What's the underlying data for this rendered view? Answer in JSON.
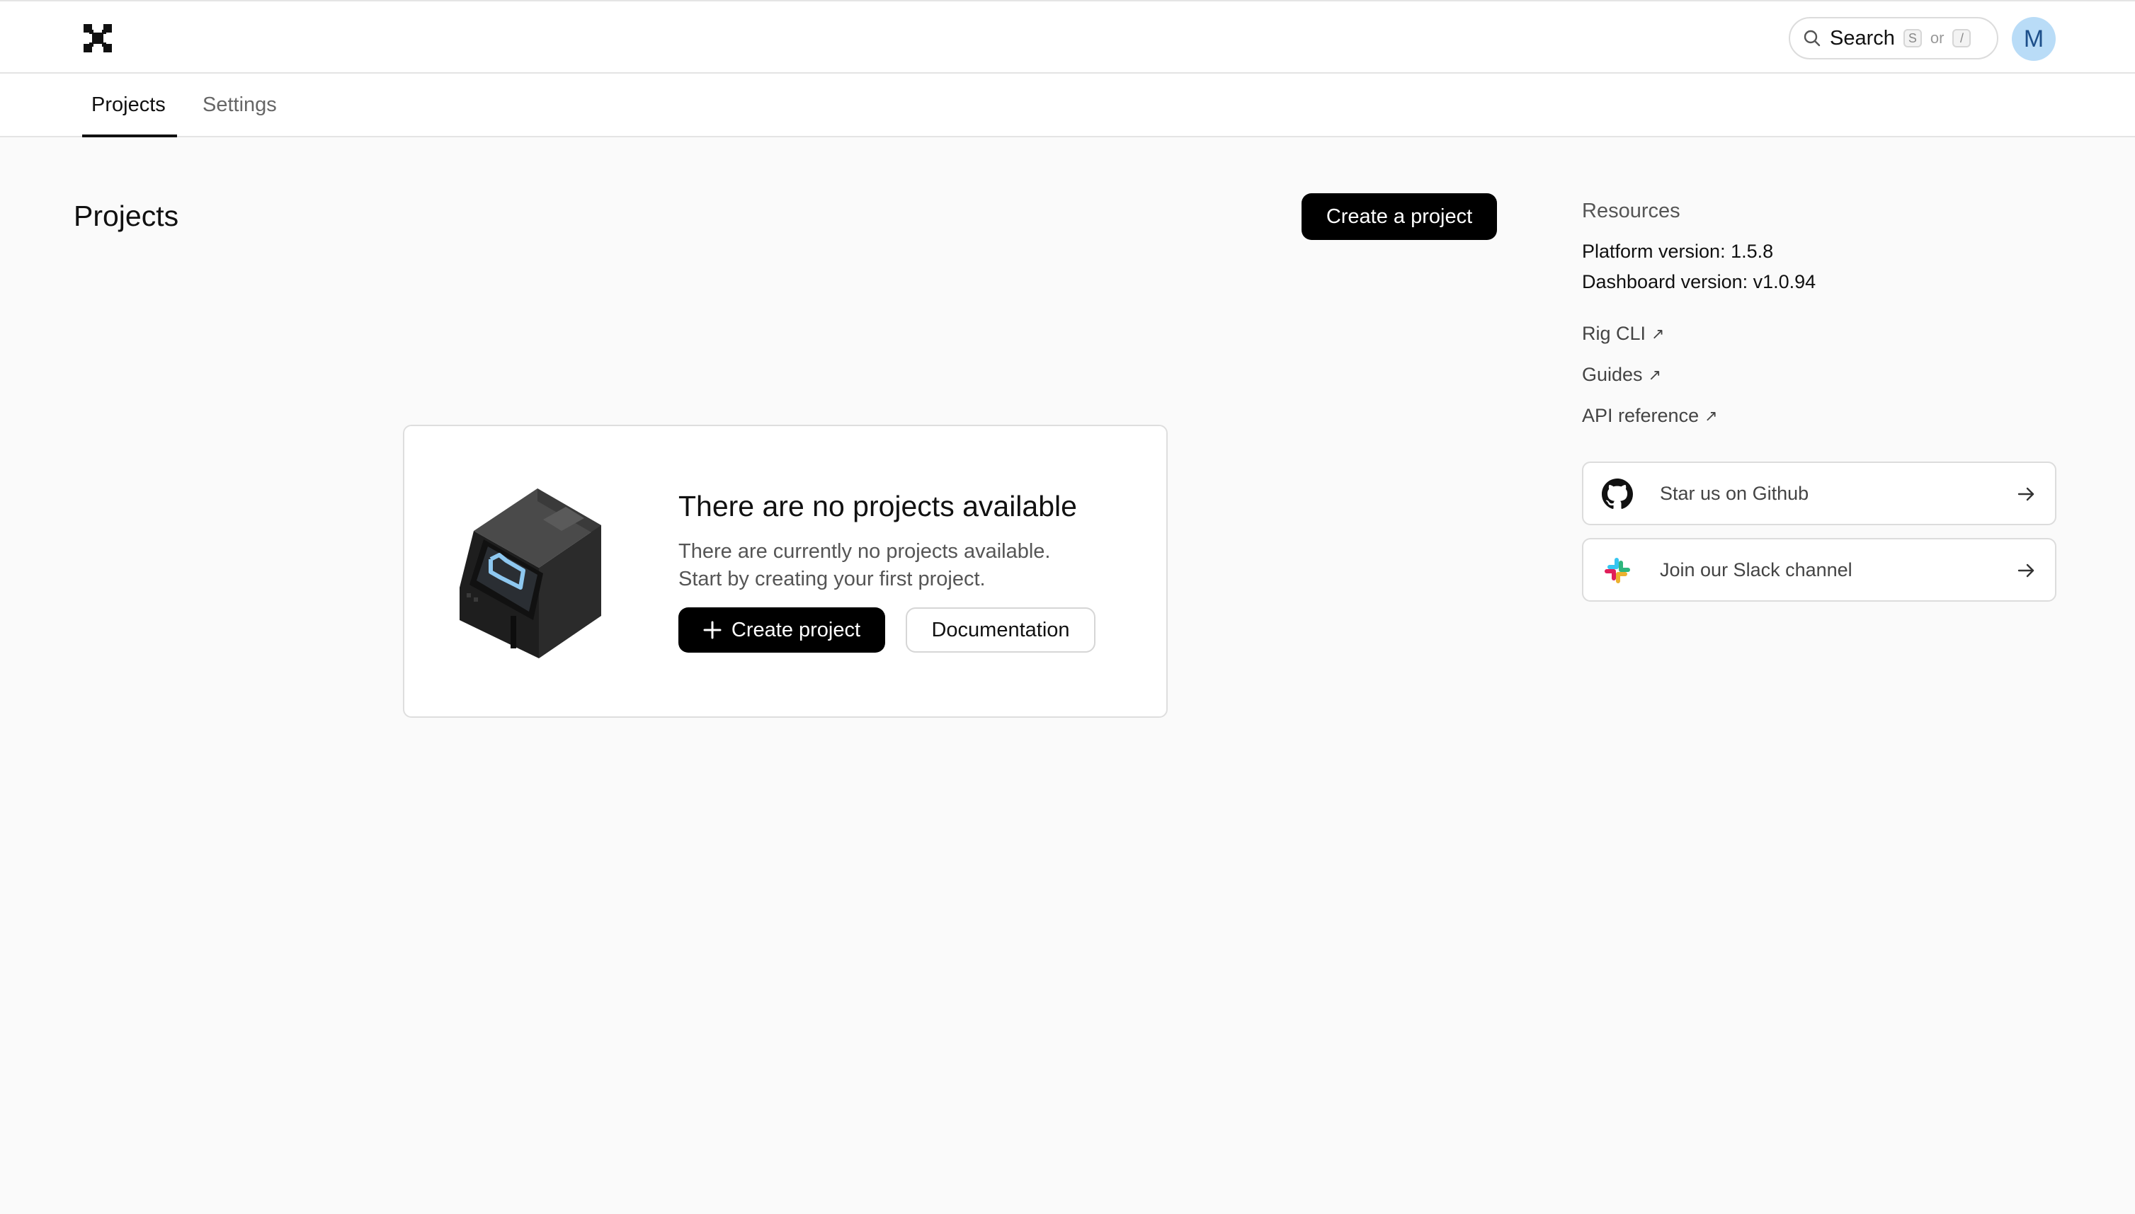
{
  "header": {
    "search_label": "Search",
    "search_key_1": "S",
    "search_or": "or",
    "search_key_2": "/",
    "avatar_initial": "M",
    "avatar_color": "#b9dcf7"
  },
  "tabs": [
    {
      "label": "Projects",
      "active": true
    },
    {
      "label": "Settings",
      "active": false
    }
  ],
  "main": {
    "title": "Projects",
    "create_button": "Create a project",
    "empty_state": {
      "title": "There are no projects available",
      "description_line1": "There are currently no projects available.",
      "description_line2": "Start by creating your first project.",
      "create_button": "Create project",
      "docs_button": "Documentation"
    }
  },
  "resources": {
    "heading": "Resources",
    "platform_version": "Platform version: 1.5.8",
    "dashboard_version": "Dashboard version: v1.0.94",
    "links": [
      {
        "label": "Rig CLI"
      },
      {
        "label": "Guides"
      },
      {
        "label": "API reference"
      }
    ],
    "cards": [
      {
        "label": "Star us on Github",
        "icon": "github-icon"
      },
      {
        "label": "Join our Slack channel",
        "icon": "slack-icon"
      }
    ]
  }
}
